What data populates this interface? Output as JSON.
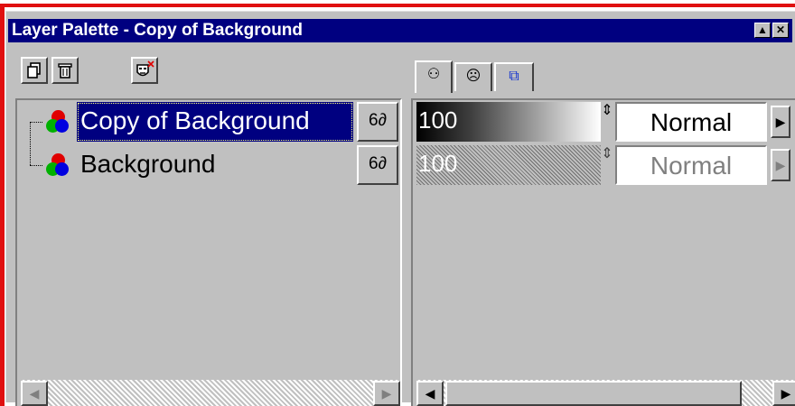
{
  "window": {
    "title": "Layer Palette - Copy of Background",
    "minimize_glyph": "▲",
    "close_glyph": "✕"
  },
  "toolbar": {
    "new_layer_icon": "new-layer-icon",
    "delete_layer_icon": "delete-layer-icon",
    "new_mask_icon": "mask-delete-icon"
  },
  "tabs": [
    {
      "icon": "layer-properties-icon",
      "glyph": "⚇"
    },
    {
      "icon": "mask-icon",
      "glyph": "☹"
    },
    {
      "icon": "link-icon",
      "glyph": "⧉"
    }
  ],
  "layers": [
    {
      "name": "Copy of Background",
      "visibility_glyph": "6∂",
      "opacity": "100",
      "blend_mode": "Normal",
      "selected": true
    },
    {
      "name": "Background",
      "visibility_glyph": "6∂",
      "opacity": "100",
      "blend_mode": "Normal",
      "selected": false
    }
  ],
  "scroll": {
    "left_arrow": "◀",
    "right_arrow": "▶"
  },
  "colors": {
    "title_bar": "#000080",
    "selection": "#000080",
    "face": "#c0c0c0",
    "frame": "#e01010"
  }
}
